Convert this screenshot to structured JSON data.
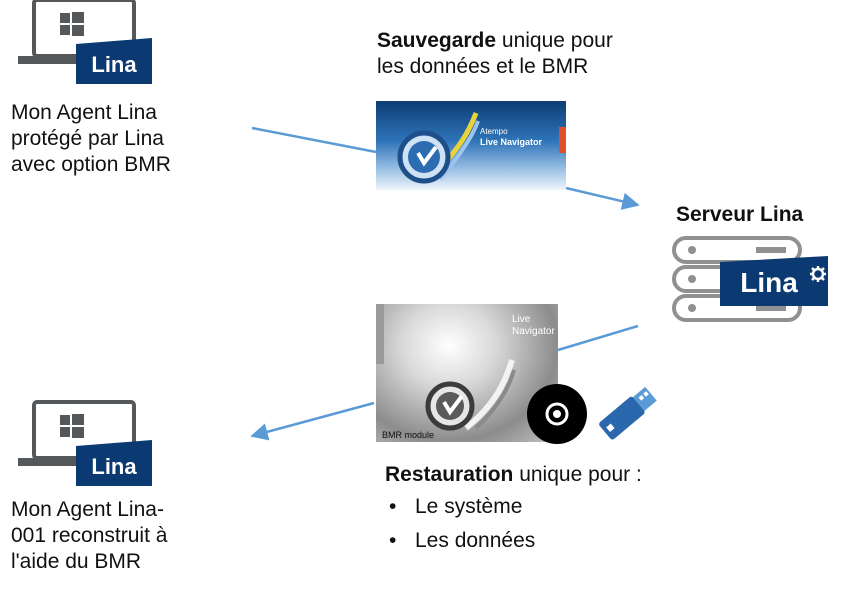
{
  "agent_top": {
    "badge": "Lina",
    "label_lines": [
      "Mon Agent Lina",
      "protégé par Lina",
      "avec option BMR"
    ]
  },
  "backup": {
    "title_bold": "Sauvegarde",
    "title_rest": " unique pour",
    "title_line2": "les données et le BMR",
    "screenshot_brand": "Atempo",
    "screenshot_product": "Live Navigator"
  },
  "server": {
    "title": "Serveur Lina",
    "badge": "Lina"
  },
  "restore": {
    "screenshot_title_line1": "Live",
    "screenshot_title_line2": "Navigator",
    "screenshot_caption": "BMR module",
    "title_bold": "Restauration",
    "title_rest": " unique pour :",
    "bullets": [
      "Le système",
      "Les données"
    ]
  },
  "agent_bottom": {
    "badge": "Lina",
    "label_lines": [
      "Mon Agent Lina-",
      "001 reconstruit à",
      "l'aide du BMR"
    ]
  },
  "colors": {
    "lina_blue": "#0b3a73",
    "arrow_blue": "#5b9bd5",
    "server_gray": "#8e9092"
  }
}
